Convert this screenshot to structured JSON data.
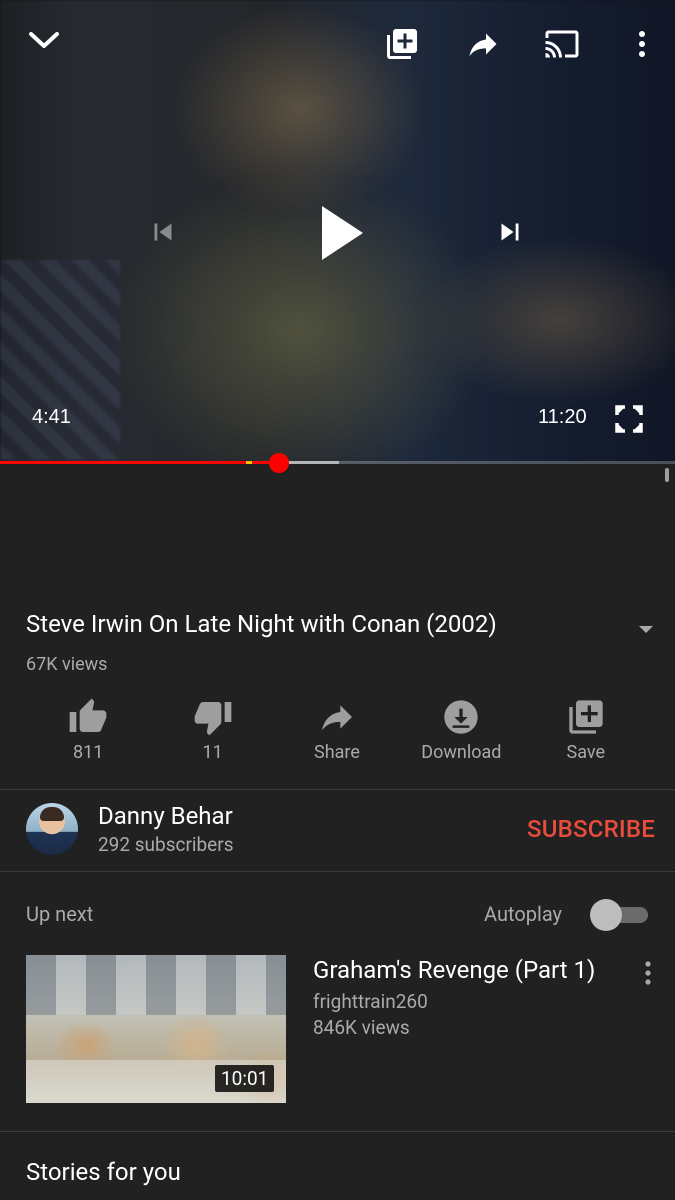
{
  "player": {
    "current_time": "4:41",
    "duration": "11:20",
    "played_fraction": 0.413,
    "buffered_fraction": 0.502,
    "icons": [
      "collapse-chevron-icon",
      "add-to-playlist-icon",
      "share-icon",
      "cast-icon",
      "more-vert-icon",
      "previous-icon",
      "play-icon",
      "next-icon",
      "fullscreen-icon"
    ],
    "accent_color": "#ff0000"
  },
  "video": {
    "title": "Steve Irwin On Late Night with Conan (2002)",
    "views": "67K views"
  },
  "actions": [
    {
      "label": "811",
      "icon": "thumbs-up-icon"
    },
    {
      "label": "11",
      "icon": "thumbs-down-icon"
    },
    {
      "label": "Share",
      "icon": "share-icon"
    },
    {
      "label": "Download",
      "icon": "download-icon"
    },
    {
      "label": "Save",
      "icon": "save-icon"
    }
  ],
  "channel": {
    "name": "Danny Behar",
    "subscribers": "292 subscribers",
    "subscribe_label": "SUBSCRIBE",
    "subscribe_color": "#e74c3c"
  },
  "up_next": {
    "heading": "Up next",
    "autoplay_label": "Autoplay",
    "autoplay_on": false
  },
  "recommendation": {
    "title": "Graham's Revenge (Part 1)",
    "channel": "frighttrain260",
    "views": "846K views",
    "duration": "10:01"
  },
  "section": {
    "stories_heading": "Stories for you"
  }
}
